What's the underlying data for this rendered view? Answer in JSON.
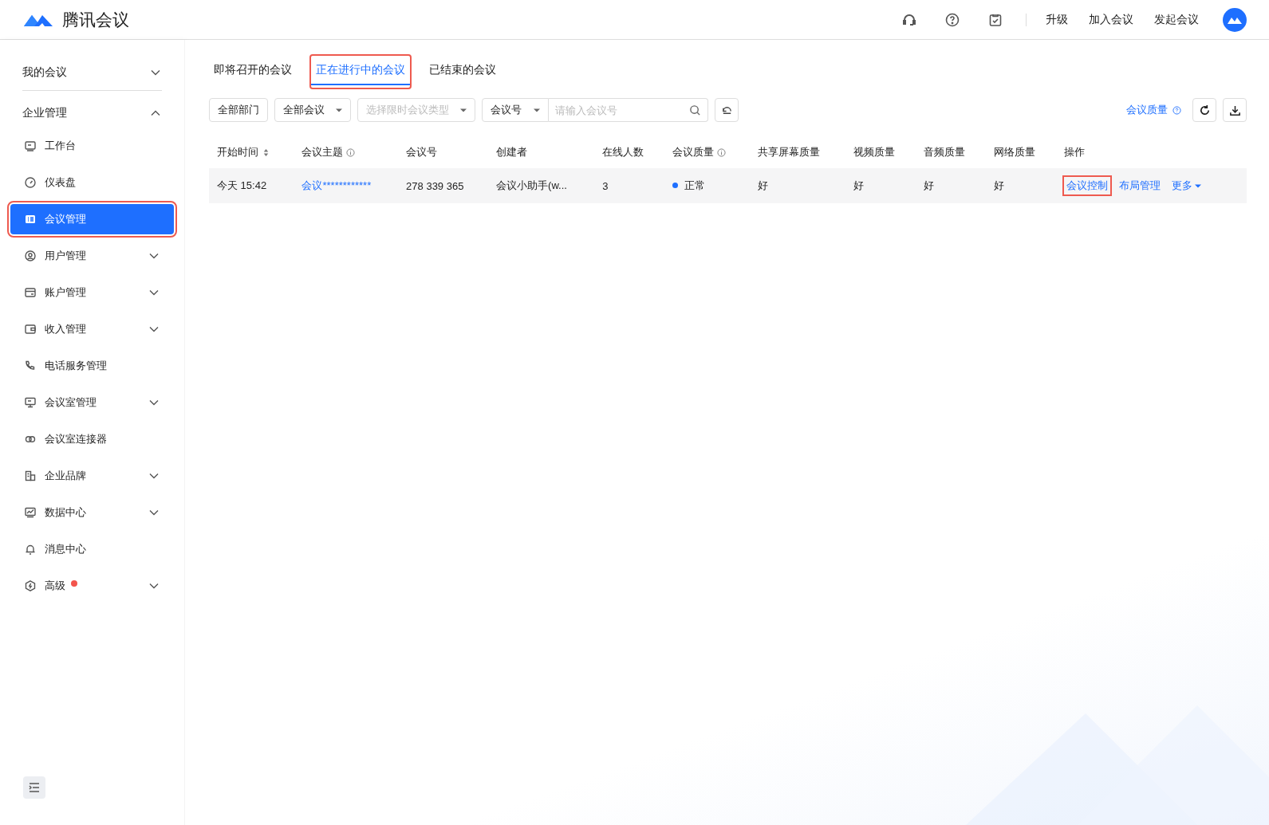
{
  "header": {
    "brand": "腾讯会议",
    "links": [
      {
        "label": "升级"
      },
      {
        "label": "加入会议"
      },
      {
        "label": "发起会议"
      }
    ]
  },
  "sidebar": {
    "sections": [
      {
        "label": "我的会议",
        "expanded": false
      },
      {
        "label": "企业管理",
        "expanded": true,
        "items": [
          {
            "label": "工作台",
            "kind": "link",
            "selected": false,
            "highlighted": false,
            "dot": false
          },
          {
            "label": "仪表盘",
            "kind": "link",
            "selected": false,
            "highlighted": false,
            "dot": false
          },
          {
            "label": "会议管理",
            "kind": "link",
            "selected": true,
            "highlighted": true,
            "dot": false
          },
          {
            "label": "用户管理",
            "kind": "group",
            "expanded": false,
            "selected": false,
            "highlighted": false,
            "dot": false
          },
          {
            "label": "账户管理",
            "kind": "group",
            "expanded": false,
            "selected": false,
            "highlighted": false,
            "dot": false
          },
          {
            "label": "收入管理",
            "kind": "group",
            "expanded": false,
            "selected": false,
            "highlighted": false,
            "dot": false
          },
          {
            "label": "电话服务管理",
            "kind": "link",
            "selected": false,
            "highlighted": false,
            "dot": false
          },
          {
            "label": "会议室管理",
            "kind": "group",
            "expanded": false,
            "selected": false,
            "highlighted": false,
            "dot": false
          },
          {
            "label": "会议室连接器",
            "kind": "link",
            "selected": false,
            "highlighted": false,
            "dot": false
          },
          {
            "label": "企业品牌",
            "kind": "group",
            "expanded": false,
            "selected": false,
            "highlighted": false,
            "dot": false
          },
          {
            "label": "数据中心",
            "kind": "group",
            "expanded": false,
            "selected": false,
            "highlighted": false,
            "dot": false
          },
          {
            "label": "消息中心",
            "kind": "link",
            "selected": false,
            "highlighted": false,
            "dot": false
          },
          {
            "label": "高级",
            "kind": "group",
            "expanded": false,
            "selected": false,
            "highlighted": false,
            "dot": true
          }
        ]
      }
    ]
  },
  "tabs": [
    {
      "label": "即将召开的会议",
      "selected": false,
      "highlighted": false
    },
    {
      "label": "正在进行中的会议",
      "selected": true,
      "highlighted": true
    },
    {
      "label": "已结束的会议",
      "selected": false,
      "highlighted": false
    }
  ],
  "filters": {
    "department": "全部部门",
    "meeting_type": "全部会议",
    "limit_type_placeholder": "选择限时会议类型",
    "search_by": "会议号",
    "search_placeholder": "请输入会议号"
  },
  "quality_link": "会议质量",
  "table": {
    "columns": [
      {
        "label": "开始时间",
        "kind": "sort"
      },
      {
        "label": "会议主题",
        "kind": "info"
      },
      {
        "label": "会议号",
        "kind": "plain"
      },
      {
        "label": "创建者",
        "kind": "plain"
      },
      {
        "label": "在线人数",
        "kind": "plain"
      },
      {
        "label": "会议质量",
        "kind": "info"
      },
      {
        "label": "共享屏幕质量",
        "kind": "plain"
      },
      {
        "label": "视频质量",
        "kind": "plain"
      },
      {
        "label": "音频质量",
        "kind": "plain"
      },
      {
        "label": "网络质量",
        "kind": "plain"
      },
      {
        "label": "操作",
        "kind": "plain"
      }
    ],
    "rows": [
      {
        "start_time": "今天  15:42",
        "topic": "会议************",
        "meeting_id": "278 339 365",
        "creator": "会议小助手(w...",
        "online": "3",
        "quality": {
          "label": "正常",
          "color": "#1e6fff"
        },
        "share_quality": "好",
        "video_quality": "好",
        "audio_quality": "好",
        "network_quality": "好",
        "actions": [
          {
            "label": "会议控制",
            "kind": "link",
            "highlighted": true
          },
          {
            "label": "布局管理",
            "kind": "link",
            "highlighted": false
          },
          {
            "label": "更多",
            "kind": "dropdown",
            "highlighted": false
          }
        ]
      }
    ]
  }
}
